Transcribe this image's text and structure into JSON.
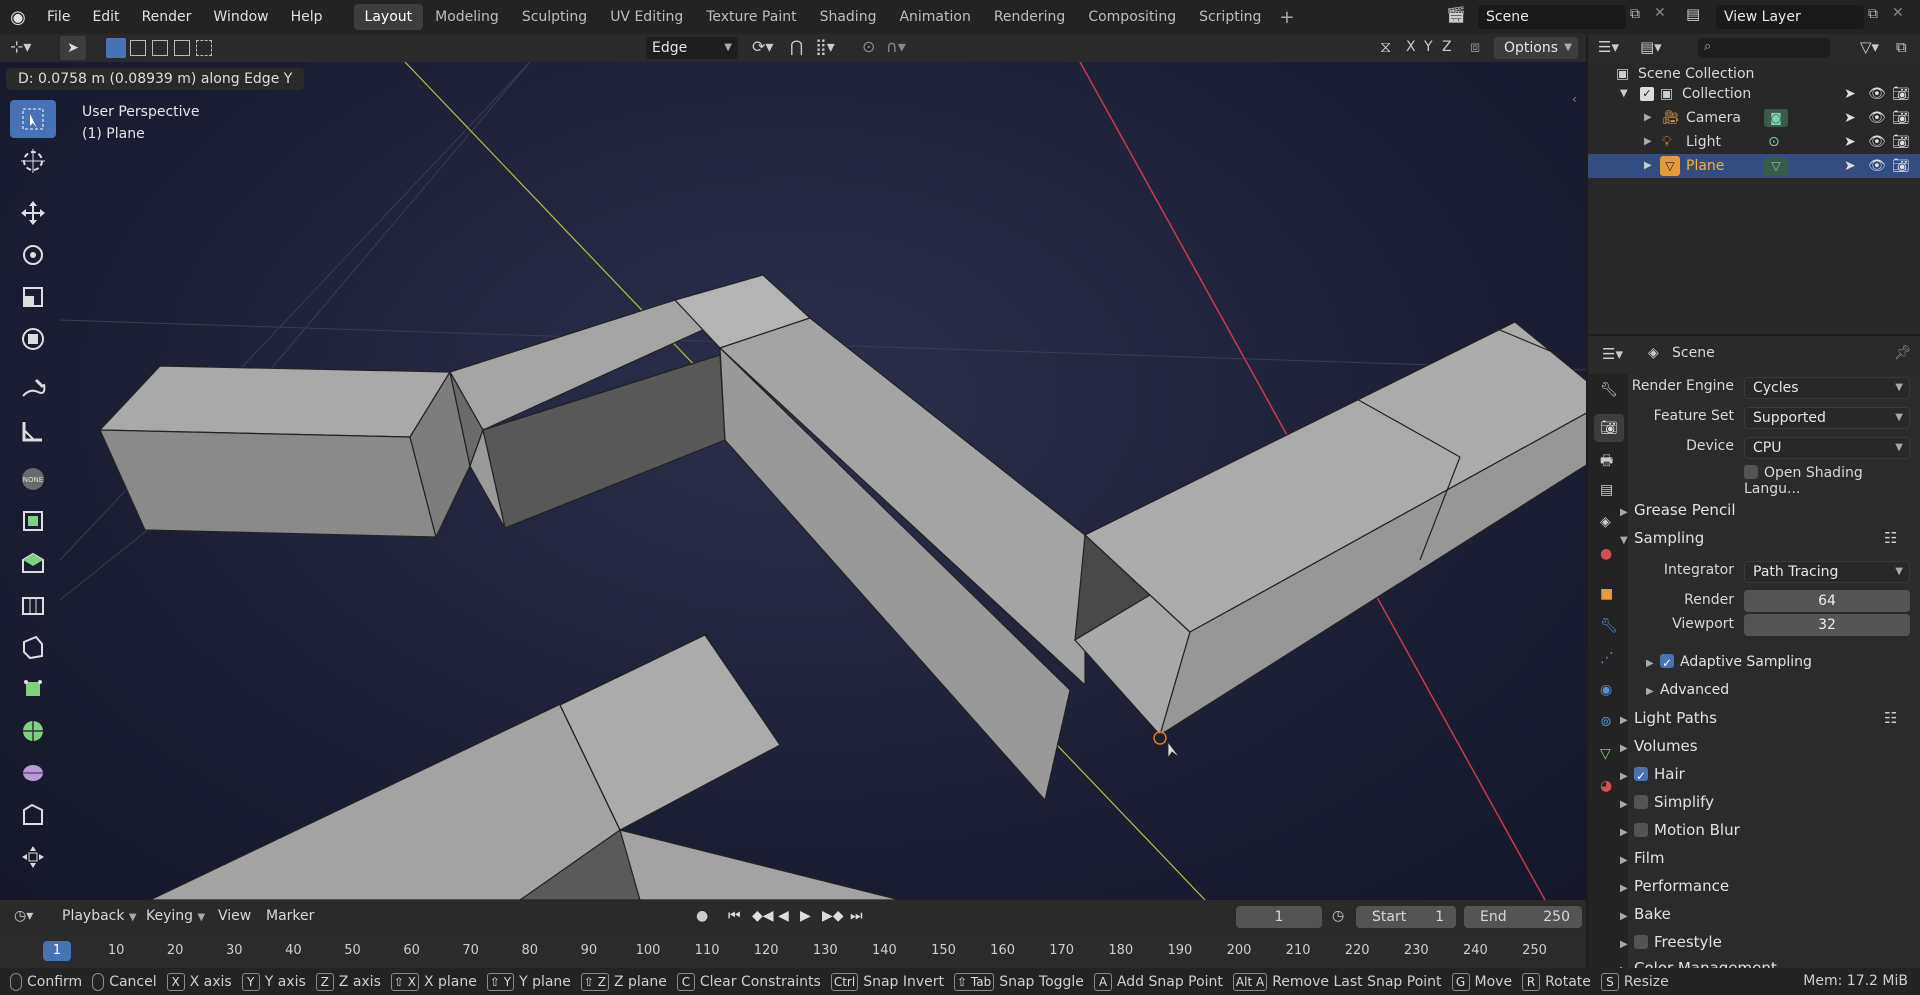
{
  "menus": [
    "File",
    "Edit",
    "Render",
    "Window",
    "Help"
  ],
  "workspaces": [
    "Layout",
    "Modeling",
    "Sculpting",
    "UV Editing",
    "Texture Paint",
    "Shading",
    "Animation",
    "Rendering",
    "Compositing",
    "Scripting"
  ],
  "scene_name": "Scene",
  "view_layer": "View Layer",
  "viewport": {
    "mode_select": "Edge",
    "options_label": "Options",
    "axes": [
      "X",
      "Y",
      "Z"
    ],
    "operator_info": "D: 0.0758 m (0.08939 m) along Edge Y",
    "perspective_label": "User Perspective",
    "object_label": "(1) Plane"
  },
  "outliner": {
    "root": "Scene Collection",
    "collection": "Collection",
    "items": [
      {
        "label": "Camera"
      },
      {
        "label": "Light"
      },
      {
        "label": "Plane"
      }
    ]
  },
  "properties": {
    "context": "Scene",
    "render_engine_label": "Render Engine",
    "render_engine": "Cycles",
    "feature_set_label": "Feature Set",
    "feature_set": "Supported",
    "device_label": "Device",
    "device": "CPU",
    "osl_label": "Open Shading Langu...",
    "grease_pencil": "Grease Pencil",
    "sampling": "Sampling",
    "integrator_label": "Integrator",
    "integrator": "Path Tracing",
    "render_label": "Render",
    "render_samples": "64",
    "viewport_label": "Viewport",
    "viewport_samples": "32",
    "adaptive_sampling": "Adaptive Sampling",
    "advanced": "Advanced",
    "light_paths": "Light Paths",
    "volumes": "Volumes",
    "hair": "Hair",
    "simplify": "Simplify",
    "motion_blur": "Motion Blur",
    "film": "Film",
    "performance": "Performance",
    "bake": "Bake",
    "freestyle": "Freestyle",
    "color_management": "Color Management"
  },
  "timeline": {
    "menus": [
      "Playback",
      "Keying",
      "View",
      "Marker"
    ],
    "current_frame": "1",
    "start_label": "Start",
    "start": "1",
    "end_label": "End",
    "end": "250",
    "ticks": [
      "1",
      "10",
      "20",
      "30",
      "40",
      "50",
      "60",
      "70",
      "80",
      "90",
      "100",
      "110",
      "120",
      "130",
      "140",
      "150",
      "160",
      "170",
      "180",
      "190",
      "200",
      "210",
      "220",
      "230",
      "240",
      "250"
    ]
  },
  "statusbar": {
    "items": [
      {
        "key": "",
        "label": "Confirm"
      },
      {
        "key": "",
        "label": "Cancel"
      },
      {
        "key": "X",
        "label": "X axis"
      },
      {
        "key": "Y",
        "label": "Y axis"
      },
      {
        "key": "Z",
        "label": "Z axis"
      },
      {
        "key": "⇧ X",
        "label": "X plane"
      },
      {
        "key": "⇧ Y",
        "label": "Y plane"
      },
      {
        "key": "⇧ Z",
        "label": "Z plane"
      },
      {
        "key": "C",
        "label": "Clear Constraints"
      },
      {
        "key": "Ctrl",
        "label": "Snap Invert"
      },
      {
        "key": "⇧ Tab",
        "label": "Snap Toggle"
      },
      {
        "key": "A",
        "label": "Add Snap Point"
      },
      {
        "key": "Alt A",
        "label": "Remove Last Snap Point"
      },
      {
        "key": "G",
        "label": "Move"
      },
      {
        "key": "R",
        "label": "Rotate"
      },
      {
        "key": "S",
        "label": "Resize"
      }
    ],
    "memory": "Mem: 17.2 MiB"
  },
  "colors": {
    "accent": "#4772b3",
    "selected_row": "#334d80",
    "active_text": "#ffaf29",
    "x_axis": "#c23c4c",
    "y_axis": "#b5c242"
  }
}
